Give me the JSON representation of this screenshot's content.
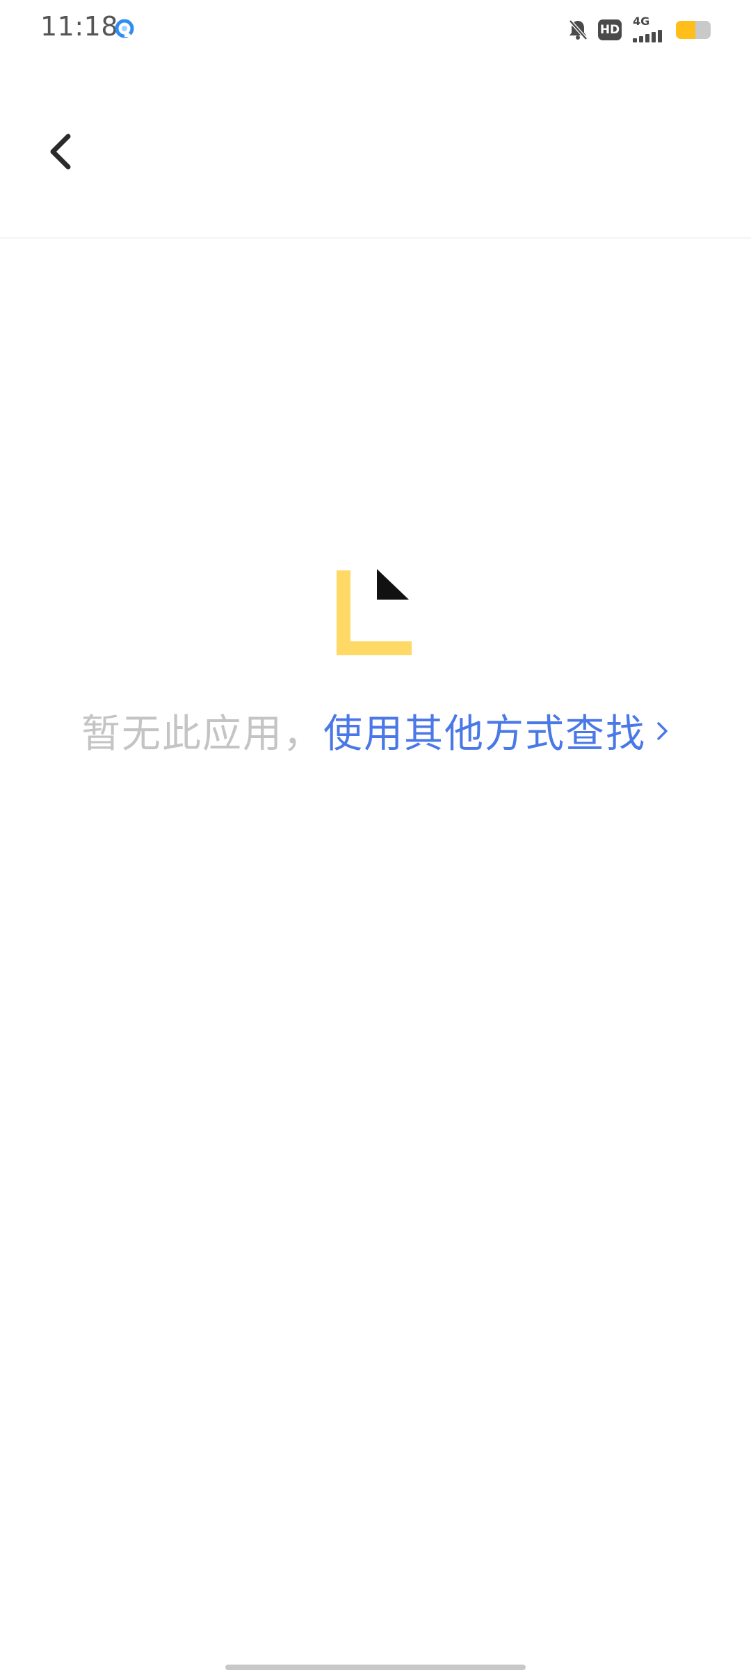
{
  "status_bar": {
    "time": "11:18",
    "network_type": "4G",
    "hd_label": "HD",
    "battery_level": 0.55,
    "colors": {
      "icon": "#4a4a4a",
      "battery_fill": "#ffbe1a",
      "app_icon": "#2e8ef0"
    },
    "icons": [
      "app-notification-icon",
      "mute-bell-icon",
      "hd-icon",
      "signal-icon",
      "battery-icon"
    ]
  },
  "header": {
    "back_icon": "chevron-left-icon"
  },
  "empty_state": {
    "message": "暂无此应用，",
    "link_label": "使用其他方式查找",
    "link_icon": "chevron-right-icon",
    "colors": {
      "message": "#c4c4c4",
      "link": "#4a78e8",
      "illustration_accent": "#ffd966",
      "illustration_dark": "#111111"
    }
  }
}
